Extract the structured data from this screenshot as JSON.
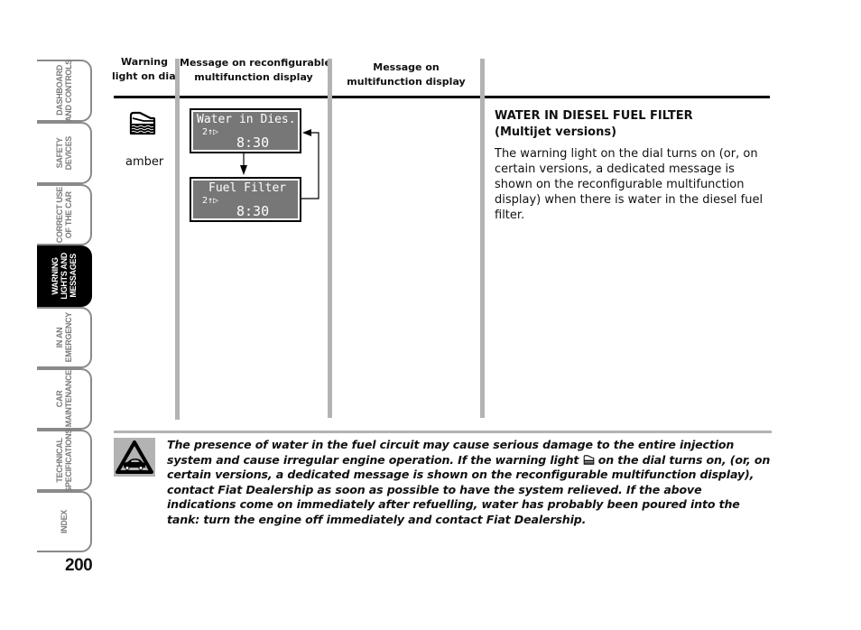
{
  "side_tabs": [
    {
      "label": "DASHBOARD\nAND CONTROLS",
      "active": false
    },
    {
      "label": "SAFETY\nDEVICES",
      "active": false
    },
    {
      "label": "CORRECT USE\nOF THE CAR",
      "active": false
    },
    {
      "label": "WARNING\nLIGHTS AND\nMESSAGES",
      "active": true
    },
    {
      "label": "IN AN\nEMERGENCY",
      "active": false
    },
    {
      "label": "CAR\nMAINTENANCE",
      "active": false
    },
    {
      "label": "TECHNICAL\nSPECIFICATIONS",
      "active": false
    },
    {
      "label": "INDEX",
      "active": false
    }
  ],
  "page_number": "200",
  "table": {
    "headers": [
      "Warning\nlight on dial",
      "Message on reconfigurable\nmultifunction display",
      "Message on\nmultifunction display"
    ],
    "warning_light": {
      "icon": "water-in-fuel-icon",
      "color_label": "amber"
    },
    "displays": [
      {
        "title": "Water in Dies.",
        "gear": "2↑▷",
        "time": "8:30"
      },
      {
        "title": "Fuel Filter",
        "gear": "2↑▷",
        "time": "8:30"
      }
    ],
    "description": {
      "title": "WATER IN DIESEL FUEL FILTER",
      "subtitle": "(Multijet versions)",
      "body": "The warning light on the dial turns on (or, on certain versions, a dedicated message is shown on the reconfigurable multifunction display) when there is water in the diesel fuel filter."
    }
  },
  "warning_note": {
    "icon": "warning-triangle-car-icon",
    "text_before_icon": "The presence of water in the fuel circuit may cause serious damage to the entire injection system and cause irregular engine operation. If the warning light ",
    "text_after_icon": " on the dial turns on, (or, on certain versions, a dedicated message is shown on the reconfigurable multifunction display), contact Fiat Dealership as soon as possible to have the system relieved. If the above indications come on immediately after refuelling, water has probably been poured into the tank: turn the engine off immediately and contact Fiat Dealership."
  },
  "colors": {
    "lcd_background": "#777777",
    "column_bar": "#b3b3b3",
    "active_tab": "#000000",
    "tab_border": "#8a8a8a"
  }
}
